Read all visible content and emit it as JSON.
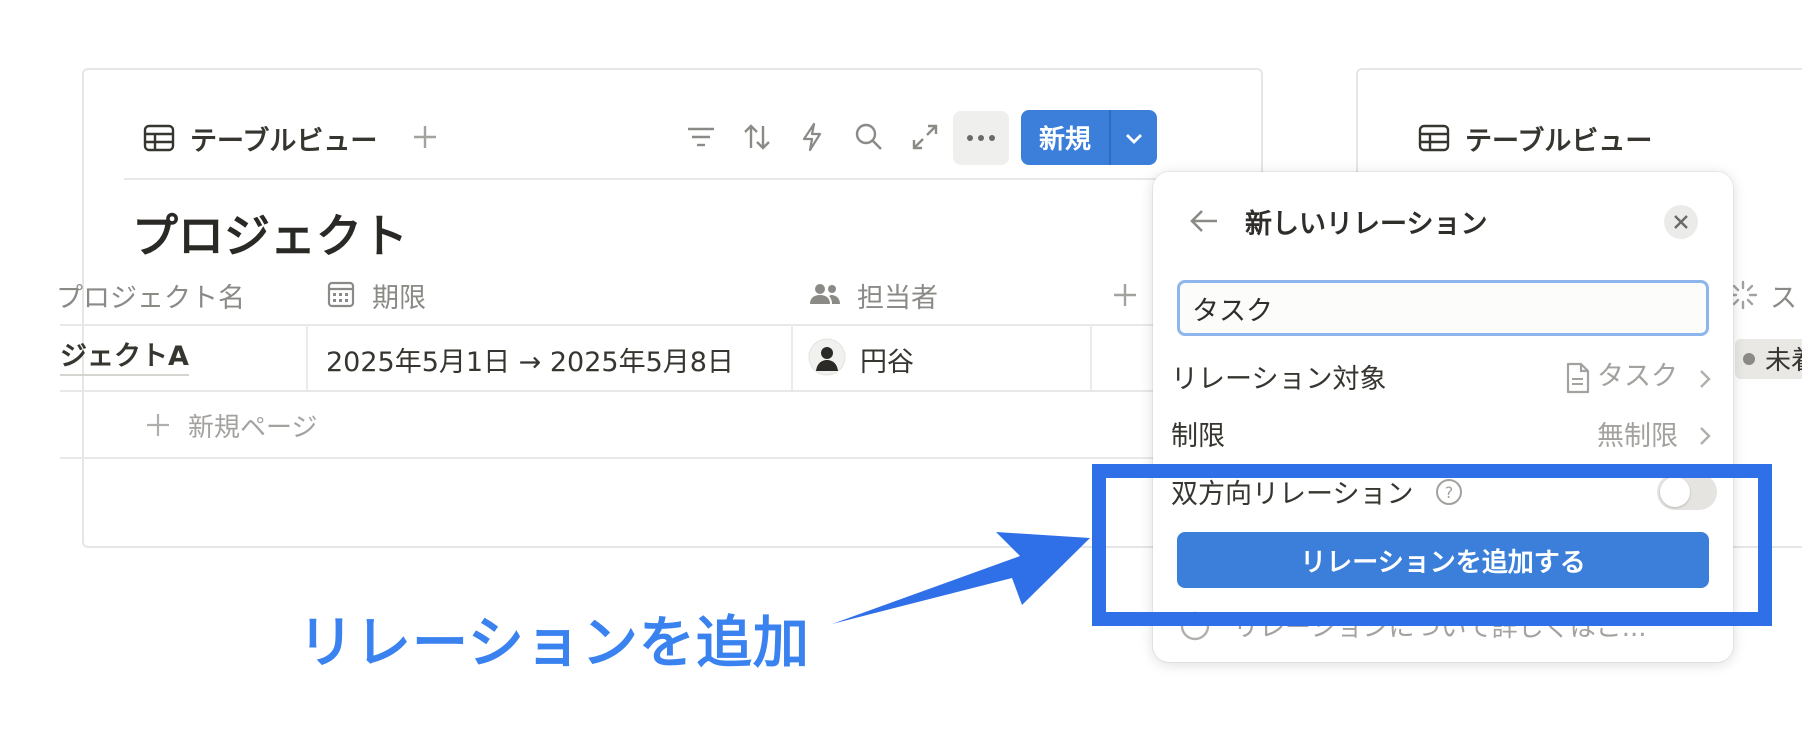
{
  "left_panel": {
    "view_tab_label": "テーブルビュー",
    "new_button_label": "新規",
    "database_title": "プロジェクト",
    "columns": [
      {
        "label": "プロジェクト名",
        "icon": "text-icon"
      },
      {
        "label": "期限",
        "icon": "calendar-icon"
      },
      {
        "label": "担当者",
        "icon": "people-icon"
      }
    ],
    "row": {
      "name": "ジェクトA",
      "deadline": "2025年5月1日 → 2025年5月8日",
      "assignee": "円谷"
    },
    "new_page_label": "新規ページ"
  },
  "right_panel": {
    "view_tab_label": "テーブルビュー",
    "partial_column_label": "ス",
    "partial_status_label": "未着"
  },
  "popover": {
    "title": "新しいリレーション",
    "search_value": "タスク",
    "relation_target_label": "リレーション対象",
    "relation_target_value": "タスク",
    "limit_label": "制限",
    "limit_value": "無制限",
    "two_way_label": "双方向リレーション",
    "two_way_enabled": false,
    "add_button_label": "リレーションを追加する",
    "learn_more_label": "リレーションについて詳しくはこ..."
  },
  "annotation": {
    "callout_text": "リレーションを追加",
    "color": "#2f6fe8"
  },
  "colors": {
    "accent": "#3b7fdb",
    "text": "#37352f",
    "muted": "#8b8a86"
  }
}
